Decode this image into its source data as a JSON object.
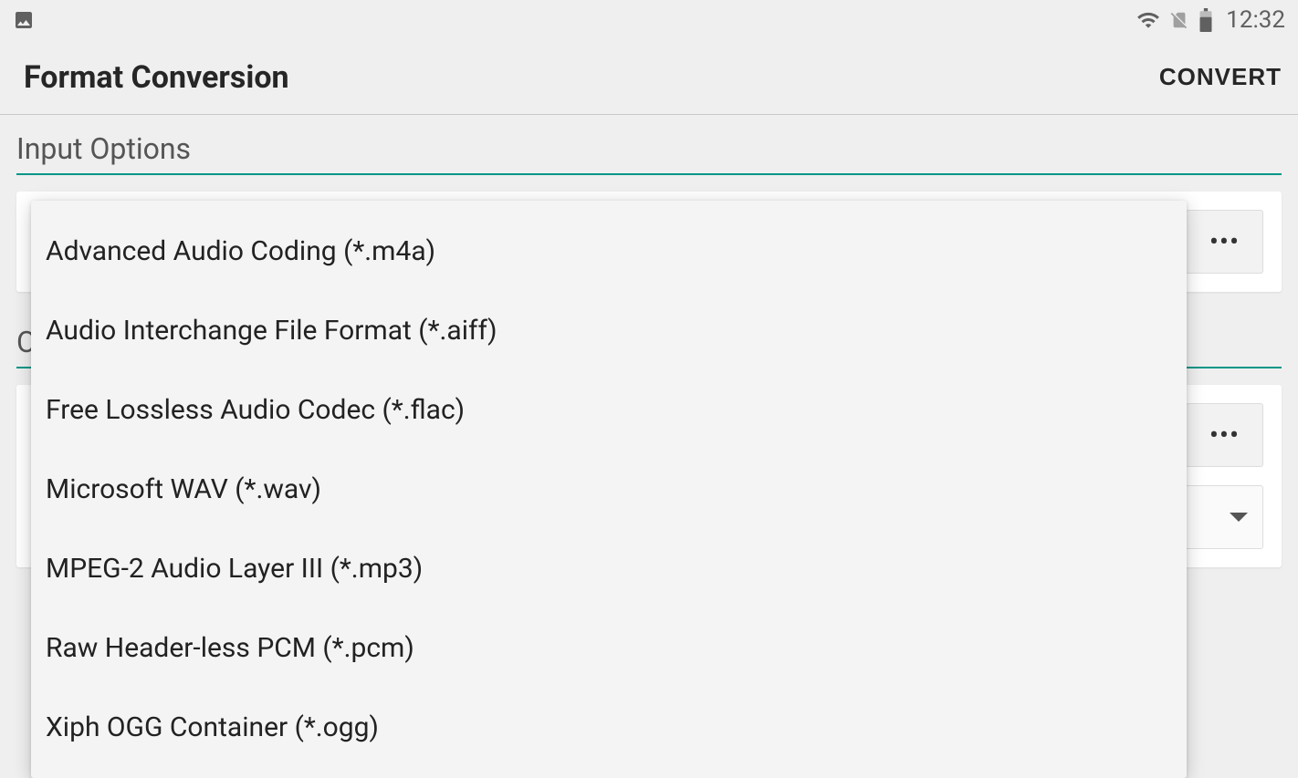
{
  "status_bar": {
    "time": "12:32"
  },
  "app_bar": {
    "title": "Format Conversion",
    "action": "CONVERT"
  },
  "sections": {
    "input_header": "Input Options",
    "output_header_peek": "O"
  },
  "dropdown_items": [
    "Advanced Audio Coding (*.m4a)",
    "Audio Interchange File Format (*.aiff)",
    "Free Lossless Audio Codec (*.flac)",
    "Microsoft WAV (*.wav)",
    "MPEG-2 Audio Layer III (*.mp3)",
    "Raw Header-less PCM (*.pcm)",
    "Xiph OGG Container (*.ogg)"
  ],
  "more_button_label": "•••"
}
